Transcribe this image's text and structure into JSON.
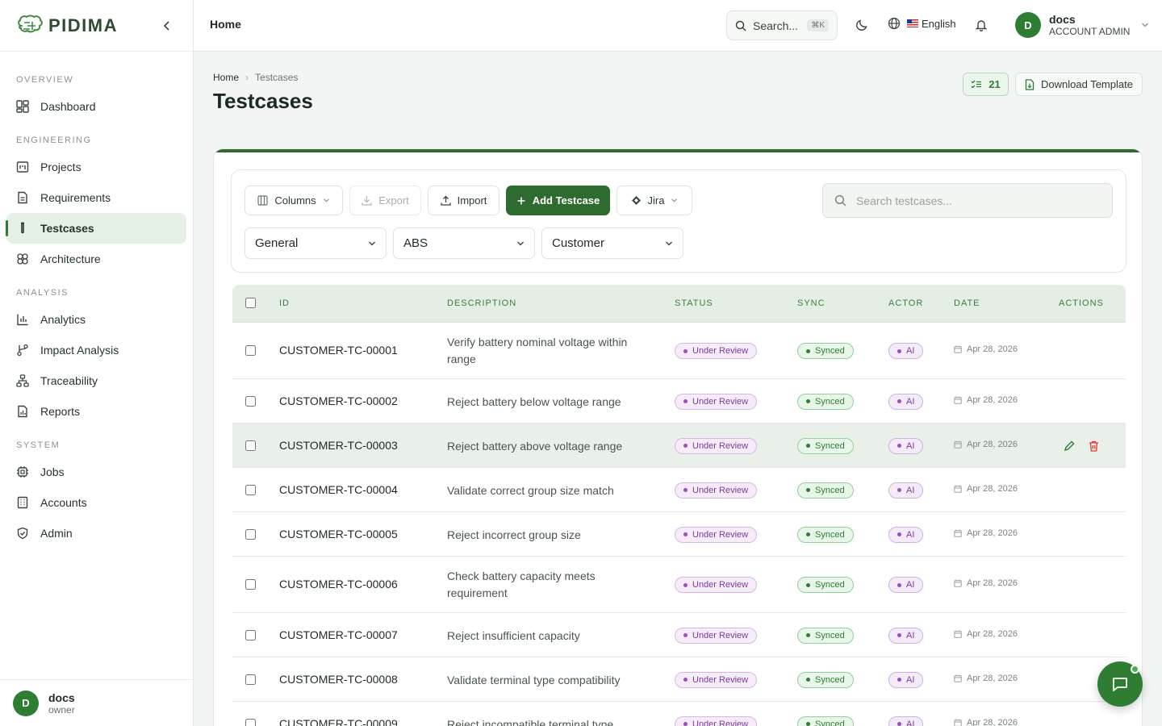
{
  "app": {
    "brand": "PIDIMA"
  },
  "topbar": {
    "title": "Home",
    "search_label": "Search...",
    "search_shortcut": "⌘K",
    "language": "English",
    "user_name": "docs",
    "user_role": "ACCOUNT ADMIN",
    "user_initial": "D"
  },
  "sidebar": {
    "sections": {
      "overview": "OVERVIEW",
      "engineering": "ENGINEERING",
      "analysis": "ANALYSIS",
      "system": "SYSTEM"
    },
    "items": {
      "dashboard": "Dashboard",
      "projects": "Projects",
      "requirements": "Requirements",
      "testcases": "Testcases",
      "architecture": "Architecture",
      "analytics": "Analytics",
      "impact": "Impact Analysis",
      "traceability": "Traceability",
      "reports": "Reports",
      "jobs": "Jobs",
      "accounts": "Accounts",
      "admin": "Admin"
    },
    "active": "testcases",
    "footer": {
      "name": "docs",
      "role": "owner",
      "initial": "D"
    }
  },
  "page": {
    "breadcrumb": [
      "Home",
      "Testcases"
    ],
    "title": "Testcases",
    "count": "21",
    "download_template": "Download Template"
  },
  "toolbar": {
    "columns": "Columns",
    "export": "Export",
    "import": "Import",
    "add": "Add Testcase",
    "jira": "Jira",
    "search_placeholder": "Search testcases...",
    "filters": [
      "General",
      "ABS",
      "Customer"
    ]
  },
  "table": {
    "headers": {
      "id": "ID",
      "description": "DESCRIPTION",
      "status": "STATUS",
      "sync": "SYNC",
      "actor": "ACTOR",
      "date": "DATE",
      "actions": "ACTIONS"
    },
    "rows": [
      {
        "id": "CUSTOMER-TC-00001",
        "description": "Verify battery nominal voltage within range",
        "status": "Under Review",
        "sync": "Synced",
        "actor": "AI",
        "date": "Apr 28, 2026"
      },
      {
        "id": "CUSTOMER-TC-00002",
        "description": "Reject battery below voltage range",
        "status": "Under Review",
        "sync": "Synced",
        "actor": "AI",
        "date": "Apr 28, 2026"
      },
      {
        "id": "CUSTOMER-TC-00003",
        "description": "Reject battery above voltage range",
        "status": "Under Review",
        "sync": "Synced",
        "actor": "AI",
        "date": "Apr 28, 2026"
      },
      {
        "id": "CUSTOMER-TC-00004",
        "description": "Validate correct group size match",
        "status": "Under Review",
        "sync": "Synced",
        "actor": "AI",
        "date": "Apr 28, 2026"
      },
      {
        "id": "CUSTOMER-TC-00005",
        "description": "Reject incorrect group size",
        "status": "Under Review",
        "sync": "Synced",
        "actor": "AI",
        "date": "Apr 28, 2026"
      },
      {
        "id": "CUSTOMER-TC-00006",
        "description": "Check battery capacity meets requirement",
        "status": "Under Review",
        "sync": "Synced",
        "actor": "AI",
        "date": "Apr 28, 2026"
      },
      {
        "id": "CUSTOMER-TC-00007",
        "description": "Reject insufficient capacity",
        "status": "Under Review",
        "sync": "Synced",
        "actor": "AI",
        "date": "Apr 28, 2026"
      },
      {
        "id": "CUSTOMER-TC-00008",
        "description": "Validate terminal type compatibility",
        "status": "Under Review",
        "sync": "Synced",
        "actor": "AI",
        "date": "Apr 28, 2026"
      },
      {
        "id": "CUSTOMER-TC-00009",
        "description": "Reject incompatible terminal type",
        "status": "Under Review",
        "sync": "Synced",
        "actor": "AI",
        "date": "Apr 28, 2026"
      }
    ]
  },
  "colors": {
    "accent": "#2e7d32",
    "accent_dark": "#2e6b2f",
    "delete": "#e53935"
  }
}
